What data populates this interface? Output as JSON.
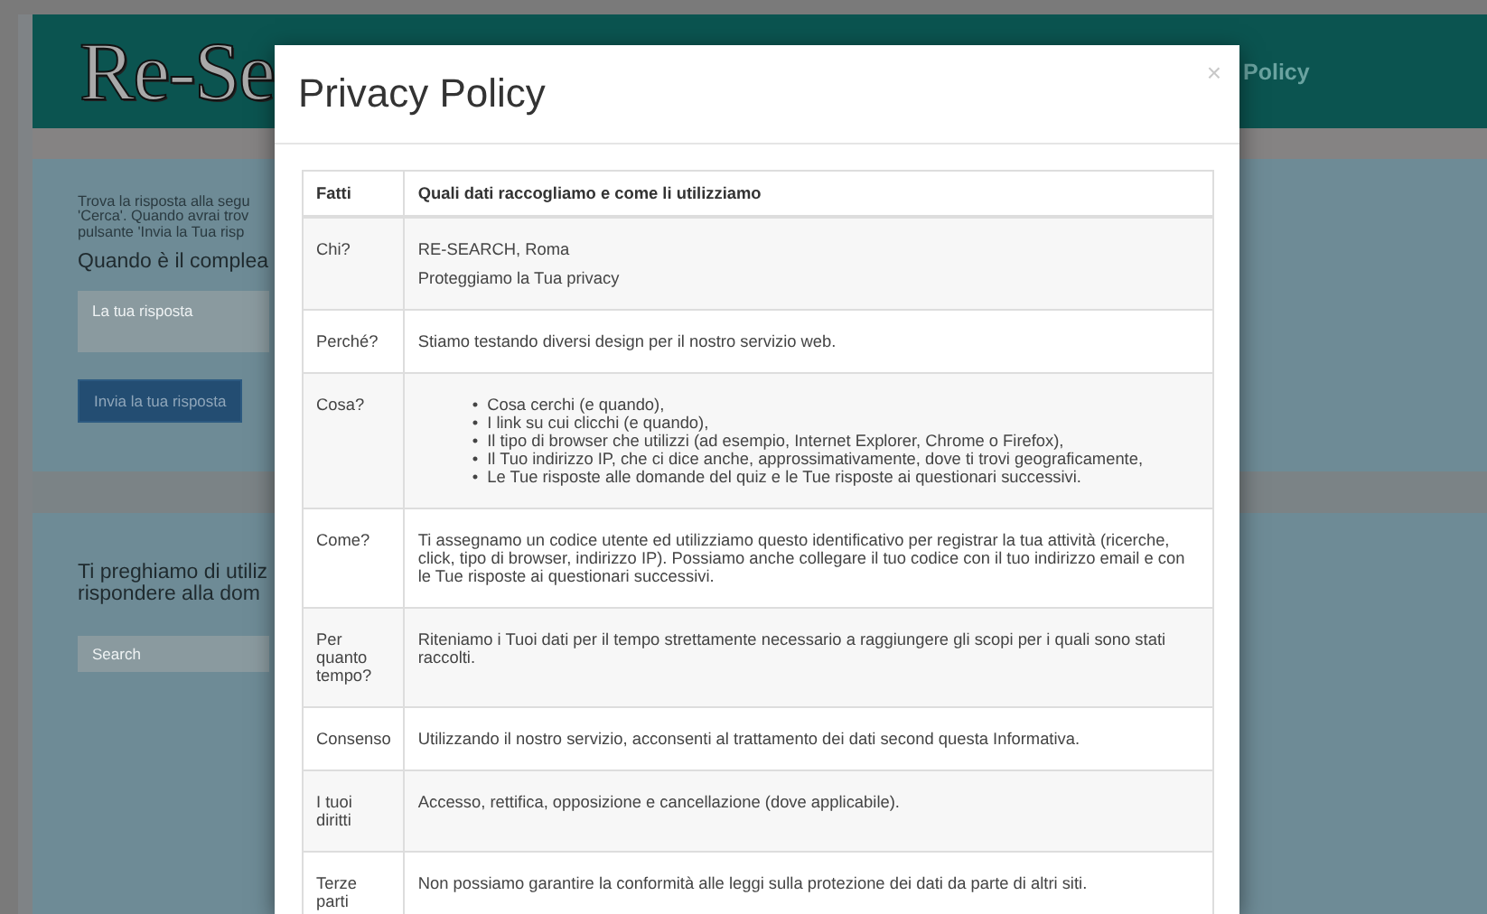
{
  "background": {
    "logo": "Re-Se",
    "nav_link": "Policy",
    "quiz_panel": {
      "instructions": [
        "Trova la risposta alla segu",
        "'Cerca'. Quando avrai trov",
        "pulsante 'Invia la Tua risp"
      ],
      "question": "Quando è il complea",
      "answer_placeholder": "La tua risposta",
      "submit_button": "Invia la tua risposta"
    },
    "search_panel": {
      "prompt": [
        "Ti preghiamo di utiliz",
        "rispondere alla dom"
      ],
      "search_placeholder": "Search"
    }
  },
  "modal": {
    "title": "Privacy Policy",
    "close": "×",
    "table": {
      "columns": [
        "Fatti",
        "Quali dati raccogliamo e come li utilizziamo"
      ],
      "rows": [
        {
          "fact": "Chi?",
          "kind": "text",
          "lines": [
            "RE-SEARCH, Roma",
            "Proteggiamo la Tua privacy"
          ]
        },
        {
          "fact": "Perché?",
          "kind": "text",
          "lines": [
            "Stiamo testando diversi design per il nostro servizio web."
          ]
        },
        {
          "fact": "Cosa?",
          "kind": "list",
          "marker": "•",
          "lines": [
            "Cosa cerchi (e quando),",
            "I link su cui clicchi (e quando),",
            "Il tipo di browser che utilizzi (ad esempio, Internet Explorer, Chrome o Firefox),",
            "Il Tuo indirizzo IP, che ci dice anche, approssimativamente, dove ti trovi geograficamente,",
            "Le Tue risposte alle domande del quiz e le Tue risposte ai questionari successivi."
          ]
        },
        {
          "fact": "Come?",
          "kind": "text",
          "lines": [
            "Ti assegnamo un codice utente ed utilizziamo questo identificativo per registrar la tua attività (ricerche, click, tipo di browser, indirizzo IP). Possiamo anche collegare il tuo codice con il tuo indirizzo email e con le Tue risposte ai questionari successivi."
          ]
        },
        {
          "fact": "Per quanto tempo?",
          "kind": "text",
          "lines": [
            "Riteniamo i Tuoi dati per il tempo strettamente necessario a raggiungere gli scopi per i quali sono stati raccolti."
          ]
        },
        {
          "fact": "Consenso",
          "kind": "text",
          "lines": [
            "Utilizzando il nostro servizio, acconsenti al trattamento dei dati second questa Informativa."
          ]
        },
        {
          "fact": "I tuoi diritti",
          "kind": "text",
          "lines": [
            "Accesso, rettifica, opposizione e cancellazione (dove applicabile)."
          ]
        },
        {
          "fact": "Terze parti",
          "kind": "text",
          "lines": [
            "Non possiamo garantire la conformità alle leggi sulla protezione dei dati da parte di altri siti."
          ]
        }
      ]
    }
  }
}
